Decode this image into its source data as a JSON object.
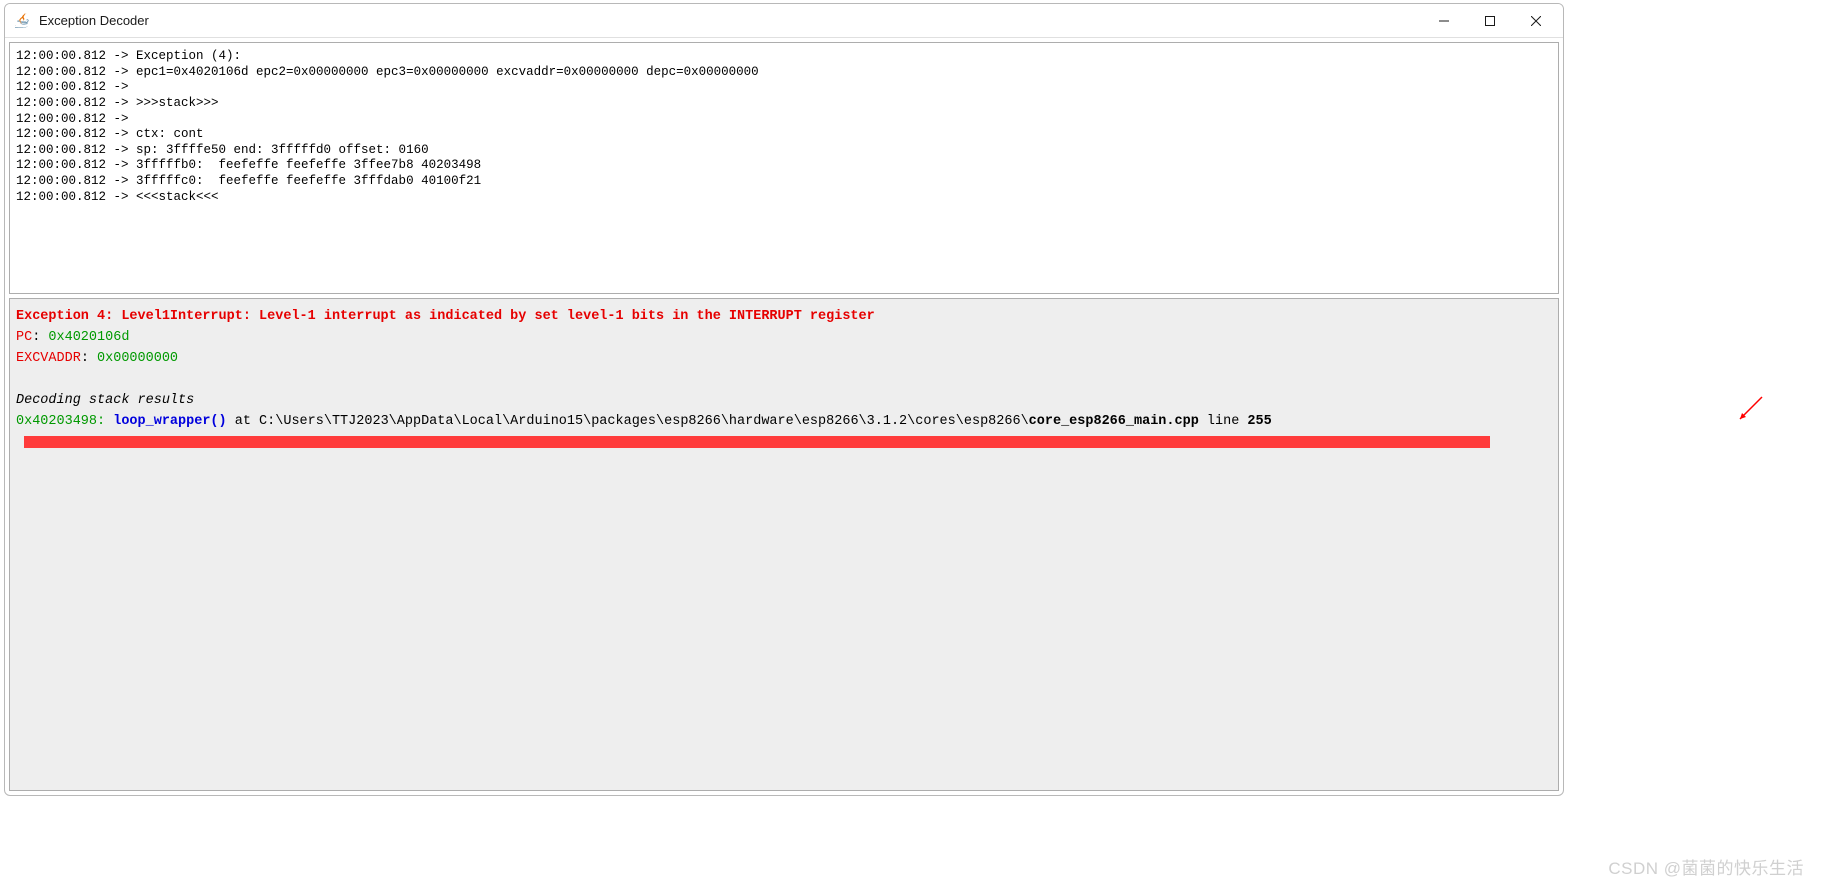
{
  "window": {
    "title": "Exception Decoder"
  },
  "topPanel": {
    "lines": [
      "12:00:00.812 -> Exception (4):",
      "12:00:00.812 -> epc1=0x4020106d epc2=0x00000000 epc3=0x00000000 excvaddr=0x00000000 depc=0x00000000",
      "12:00:00.812 -> ",
      "12:00:00.812 -> >>>stack>>>",
      "12:00:00.812 -> ",
      "12:00:00.812 -> ctx: cont",
      "12:00:00.812 -> sp: 3ffffe50 end: 3fffffd0 offset: 0160",
      "12:00:00.812 -> 3fffffb0:  feefeffe feefeffe 3ffee7b8 40203498",
      "12:00:00.812 -> 3fffffc0:  feefeffe feefeffe 3fffdab0 40100f21",
      "12:00:00.812 -> <<<stack<<<"
    ]
  },
  "bottomPanel": {
    "exceptionLine": "Exception 4: Level1Interrupt: Level-1 interrupt as indicated by set level-1 bits in the INTERRUPT register",
    "pcLabel": "PC",
    "pcSep": ": ",
    "pcValue": "0x4020106d",
    "excvaddrLabel": "EXCVADDR",
    "excvaddrSep": ": ",
    "excvaddrValue": "0x00000000",
    "stackHeader": "Decoding stack results",
    "stackAddr": "0x40203498: ",
    "stackFunc": "loop_wrapper()",
    "stackAt": " at C:\\Users\\TTJ2023\\AppData\\Local\\Arduino15\\packages\\esp8266\\hardware\\esp8266\\3.1.2\\cores\\esp8266\\",
    "stackFile": "core_esp8266_main.cpp",
    "stackLine": " line ",
    "stackLineNum": "255"
  },
  "watermark": "CSDN @菌菌的快乐生活"
}
